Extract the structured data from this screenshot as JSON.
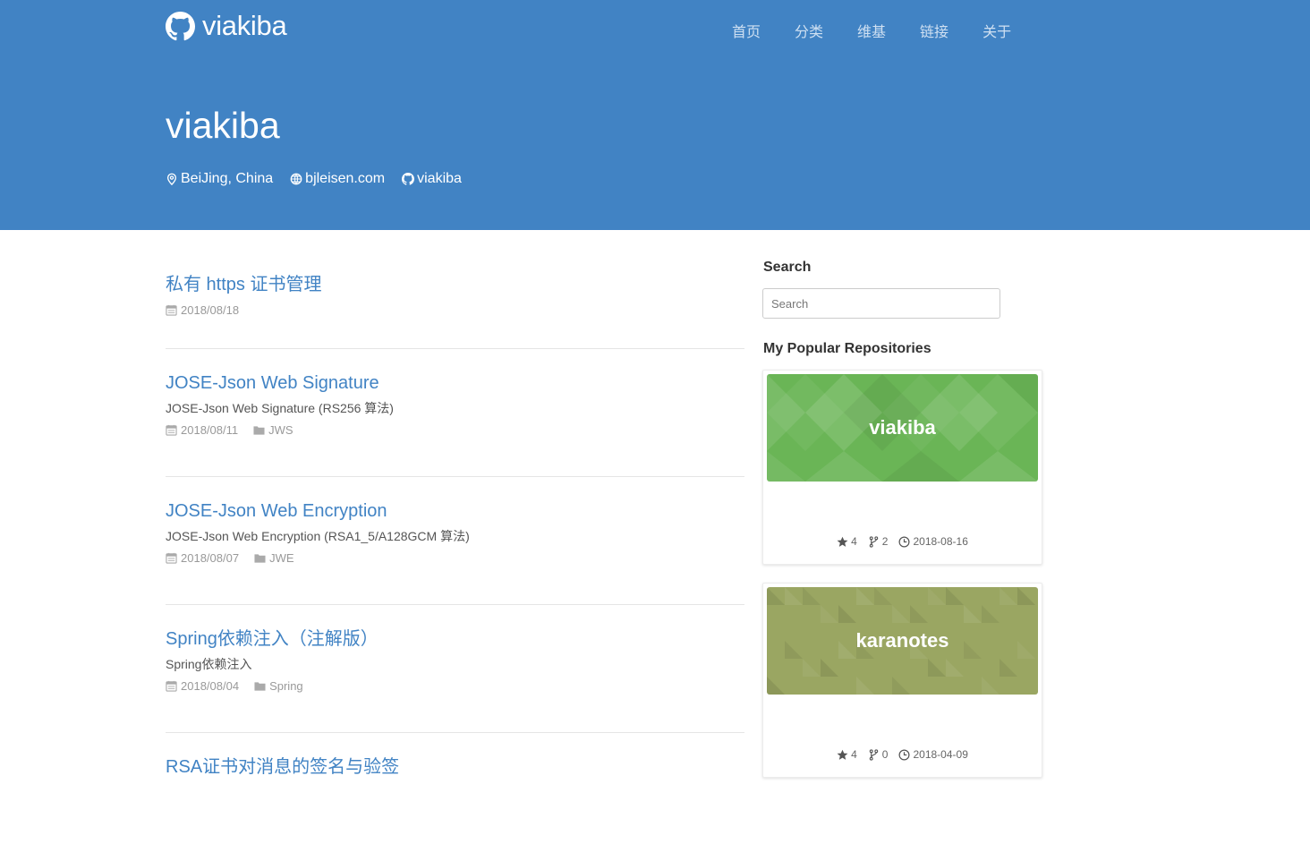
{
  "site": {
    "brand": "viakiba",
    "nav": [
      "首页",
      "分类",
      "维基",
      "链接",
      "关于"
    ]
  },
  "hero": {
    "title": "viakiba",
    "location": "BeiJing, China",
    "website": "bjleisen.com",
    "github": "viakiba"
  },
  "posts": [
    {
      "title": "私有 https 证书管理",
      "excerpt": "",
      "date": "2018/08/18",
      "category": ""
    },
    {
      "title": "JOSE-Json Web Signature",
      "excerpt": "JOSE-Json Web Signature (RS256 算法)",
      "date": "2018/08/11",
      "category": "JWS"
    },
    {
      "title": "JOSE-Json Web Encryption",
      "excerpt": "JOSE-Json Web Encryption (RSA1_5/A128GCM 算法)",
      "date": "2018/08/07",
      "category": "JWE"
    },
    {
      "title": "Spring依赖注入（注解版）",
      "excerpt": "Spring依赖注入",
      "date": "2018/08/04",
      "category": "Spring"
    },
    {
      "title": "RSA证书对消息的签名与验签",
      "excerpt": "",
      "date": "",
      "category": ""
    }
  ],
  "sidebar": {
    "search_title": "Search",
    "search_placeholder": "Search",
    "repos_title": "My Popular Repositories",
    "repos": [
      {
        "name": "viakiba",
        "stars": "4",
        "forks": "2",
        "updated": "2018-08-16",
        "color": "#6ab556"
      },
      {
        "name": "karanotes",
        "stars": "4",
        "forks": "0",
        "updated": "2018-04-09",
        "color": "#9aa662"
      }
    ]
  },
  "icons": [
    "github-icon",
    "location-icon",
    "globe-icon",
    "calendar-icon",
    "folder-icon",
    "star-icon",
    "fork-icon",
    "clock-icon"
  ],
  "colors": {
    "header": "#4183c4",
    "link": "#4183c4",
    "meta": "#999999"
  }
}
